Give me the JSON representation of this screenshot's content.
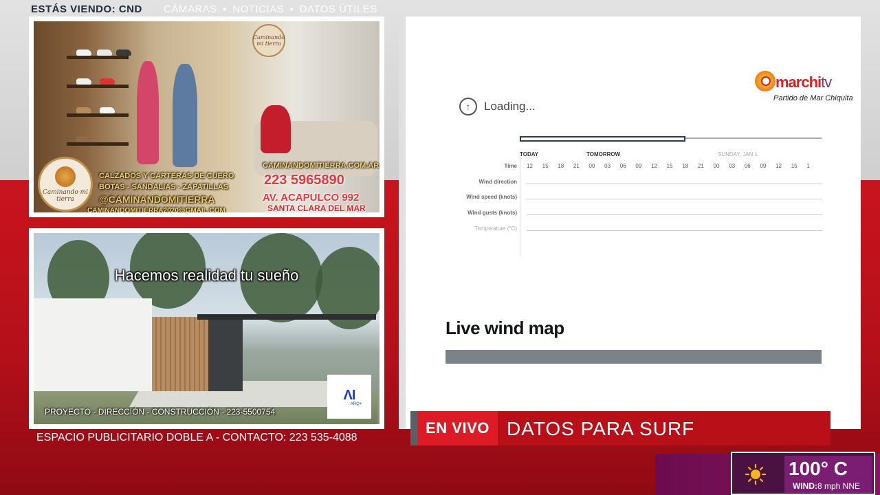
{
  "header": {
    "now_watching": "ESTÁS VIENDO: CND",
    "nav": [
      "CÁMARAS",
      "NOTICIAS",
      "DATOS ÚTILES"
    ]
  },
  "ad_store": {
    "logo_small": "Caminando mi tierra",
    "badge_name": "Caminando mi tierra",
    "line1": "CALZADOS Y CARTERAS DE CUERO",
    "line2": "BOTAS - SANDALIAS - ZAPATILLAS",
    "handle": "@CAMINANDOMITIERRA",
    "email": "CAMINANDOMITIERRA2020@GMAIL.COM",
    "website": "CAMINANDOMITIERRA.COM.AR",
    "phone": "223 5965890",
    "address": "AV. ACAPULCO 992",
    "city": "SANTA CLARA DEL MAR"
  },
  "ad_arch": {
    "headline": "Hacemos realidad tu sueño",
    "footer": "PROYECTO - DIRECCIÓN - CONSTRUCCIÓN - 223-5500754",
    "logo_mark": "ΛΙ",
    "logo_sub": "ARQ+"
  },
  "ad_contact": "ESPACIO PUBLICITARIO DOBLE A - CONTACTO: 223 535-4088",
  "brand": {
    "name_part1": "marchi",
    "name_part2": "tv",
    "tagline": "Partido de Mar Chiquita"
  },
  "forecast": {
    "loading_text": "Loading...",
    "loading_progress": 0.55,
    "days": [
      "TODAY",
      "TOMORROW",
      "SUNDAY, JAN 1"
    ],
    "time_label": "Time",
    "hours": [
      "12",
      "15",
      "18",
      "21",
      "00",
      "03",
      "06",
      "09",
      "12",
      "15",
      "18",
      "21",
      "00",
      "03",
      "06",
      "09",
      "12",
      "15",
      "1"
    ],
    "rows": [
      "Wind direction",
      "Wind speed (knots)",
      "Wind gusts (knots)",
      "Temperature (°C)"
    ],
    "section_title": "Live wind map"
  },
  "lower_third": {
    "live": "EN VIVO",
    "title": "DATOS PARA SURF"
  },
  "weather": {
    "temperature": "100° C",
    "wind_label": "WIND:",
    "wind_value": "8 mph NNE",
    "icon": "sun-icon"
  }
}
